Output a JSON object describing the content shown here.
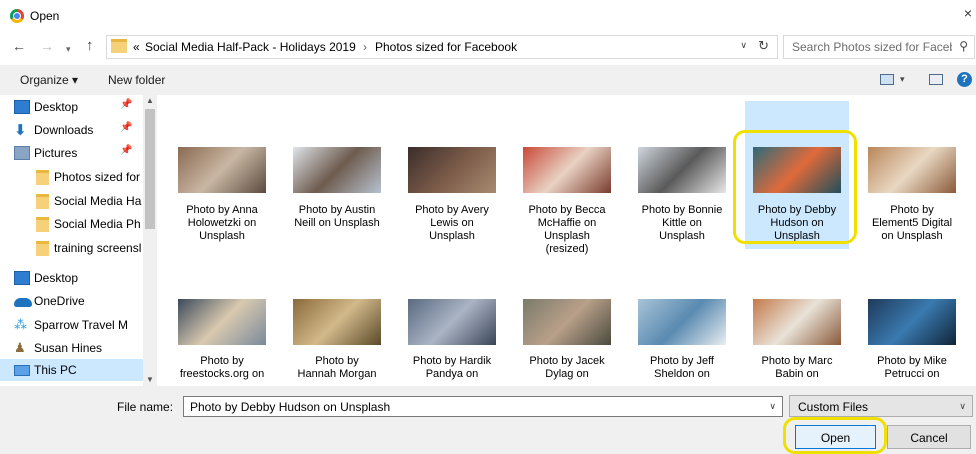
{
  "window": {
    "title": "Open",
    "close_glyph": "×",
    "app_icon": "chrome-icon"
  },
  "nav": {
    "back": "←",
    "forward": "→",
    "recent": "▾",
    "up": "↑"
  },
  "address": {
    "crumb_prefix": "«",
    "crumbs": [
      "Social Media Half-Pack - Holidays 2019",
      "Photos sized for Facebook"
    ],
    "separator": "›",
    "dropdown": "∨",
    "refresh": "↻"
  },
  "search": {
    "placeholder": "Search Photos sized for Faceb...",
    "icon": "search-icon"
  },
  "toolbar": {
    "organize_label": "Organize ▾",
    "new_folder_label": "New folder",
    "view_dd": "▾",
    "help_label": "?"
  },
  "sidebar": {
    "items": [
      {
        "label": "Desktop",
        "icon": "desktop-icon",
        "pinned": true
      },
      {
        "label": "Downloads",
        "icon": "downloads-icon",
        "pinned": true
      },
      {
        "label": "Pictures",
        "icon": "pictures-icon",
        "pinned": true
      },
      {
        "label": "Photos sized for",
        "icon": "folder-icon",
        "pinned": false
      },
      {
        "label": "Social Media Ha",
        "icon": "folder-icon",
        "pinned": false
      },
      {
        "label": "Social Media Ph",
        "icon": "folder-icon",
        "pinned": false
      },
      {
        "label": "training screensl",
        "icon": "folder-icon",
        "pinned": false
      },
      {
        "label": "Desktop",
        "icon": "desktop-icon",
        "pinned": false
      },
      {
        "label": "OneDrive",
        "icon": "onedrive-icon",
        "pinned": false
      },
      {
        "label": "Sparrow Travel M",
        "icon": "network-icon",
        "pinned": false
      },
      {
        "label": "Susan Hines",
        "icon": "user-icon",
        "pinned": false
      },
      {
        "label": "This PC",
        "icon": "pc-icon",
        "pinned": false
      }
    ],
    "pin_glyph": "📌",
    "scroll_up": "▲",
    "scroll_down": "▼"
  },
  "files": [
    {
      "lines": [
        "Photo by Anna",
        "Holowetzki on",
        "Unsplash"
      ],
      "colors": [
        "#8a6a52",
        "#c9b7a4",
        "#5b4a3e"
      ]
    },
    {
      "lines": [
        "Photo by Austin",
        "Neill on Unsplash"
      ],
      "colors": [
        "#dfe4ea",
        "#6e5b4e",
        "#b7c2cf"
      ]
    },
    {
      "lines": [
        "Photo by Avery",
        "Lewis on",
        "Unsplash"
      ],
      "colors": [
        "#3a2d2a",
        "#7a5a48",
        "#a88a70"
      ]
    },
    {
      "lines": [
        "Photo by Becca",
        "McHaffie on",
        "Unsplash",
        "(resized)"
      ],
      "colors": [
        "#c94a3a",
        "#e8d2c2",
        "#7a3b2e"
      ]
    },
    {
      "lines": [
        "Photo by Bonnie",
        "Kittle on",
        "Unsplash"
      ],
      "colors": [
        "#cfd6de",
        "#5a5a5a",
        "#e8e8e8"
      ]
    },
    {
      "lines": [
        "Photo by Debby",
        "Hudson on",
        "Unsplash"
      ],
      "colors": [
        "#2d6a78",
        "#e06a3a",
        "#1f4f5b"
      ],
      "selected": true
    },
    {
      "lines": [
        "Photo by",
        "Element5 Digital",
        "on Unsplash"
      ],
      "colors": [
        "#b9865a",
        "#e9d8c2",
        "#8a5a3a"
      ]
    },
    {
      "lines": [
        "Photo by",
        "freestocks.org on"
      ],
      "colors": [
        "#3b4a5a",
        "#d9c9b0",
        "#7a8a9a"
      ]
    },
    {
      "lines": [
        "Photo by",
        "Hannah Morgan"
      ],
      "colors": [
        "#8a6a3a",
        "#d2b98a",
        "#5a4a2a"
      ]
    },
    {
      "lines": [
        "Photo by Hardik",
        "Pandya on"
      ],
      "colors": [
        "#5a6a80",
        "#aab4c4",
        "#3a4458"
      ]
    },
    {
      "lines": [
        "Photo by Jacek",
        "Dylag on"
      ],
      "colors": [
        "#7a7a6a",
        "#b9a08a",
        "#4a4a3e"
      ]
    },
    {
      "lines": [
        "Photo by Jeff",
        "Sheldon on"
      ],
      "colors": [
        "#a8c4d8",
        "#5a8ab0",
        "#e8eef2"
      ]
    },
    {
      "lines": [
        "Photo by Marc",
        "Babin on"
      ],
      "colors": [
        "#c47a4a",
        "#e9e2d8",
        "#8a5a3a"
      ]
    },
    {
      "lines": [
        "Photo by Mike",
        "Petrucci on"
      ],
      "colors": [
        "#1f3a5a",
        "#3a7ab0",
        "#0f2438"
      ]
    }
  ],
  "bottom": {
    "file_name_label": "File name:",
    "file_name_value": "Photo by Debby Hudson on Unsplash",
    "dropdown": "∨",
    "filter_value": "Custom Files",
    "open_label": "Open",
    "cancel_label": "Cancel"
  },
  "colors": {
    "selection": "#cce8ff",
    "highlight": "#f0e000",
    "accent": "#0078d7"
  }
}
